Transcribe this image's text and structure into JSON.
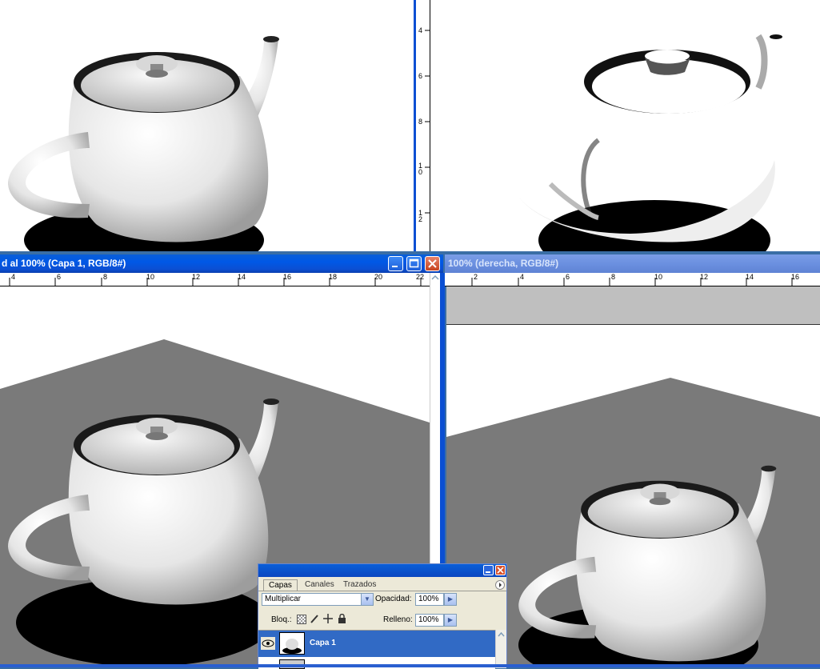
{
  "windows": {
    "bottom_left": {
      "title": "d al 100% (Capa 1, RGB/8#)",
      "ruler_top_labels": [
        "4",
        "6",
        "8",
        "10",
        "12",
        "14",
        "16",
        "18",
        "20",
        "22"
      ]
    },
    "bottom_right": {
      "title": "100% (derecha, RGB/8#)",
      "ruler_top_labels": [
        "2",
        "4",
        "6",
        "8",
        "10",
        "12",
        "14",
        "16"
      ]
    },
    "top_right": {
      "ruler_left_labels": [
        "4",
        "6",
        "8",
        "1 0",
        "1 2"
      ]
    }
  },
  "layers_panel": {
    "tabs": [
      "Capas",
      "Canales",
      "Trazados"
    ],
    "blend_mode": "Multiplicar",
    "opacity_label": "Opacidad:",
    "opacity_value": "100%",
    "lock_label": "Bloq.:",
    "fill_label": "Relleno:",
    "fill_value": "100%",
    "layers": [
      {
        "name": "Capa 1",
        "selected": true,
        "visible": true
      }
    ]
  },
  "icons": {
    "minimize": "minimize-icon",
    "maximize": "maximize-icon",
    "close": "close-icon",
    "eye": "eye-icon",
    "dropdown": "chevron-down-icon",
    "lock_transparency": "lock-transparency-icon",
    "lock_brush": "brush-icon",
    "lock_move": "move-icon",
    "lock_all": "padlock-icon",
    "panel_menu": "panel-menu-icon"
  },
  "colors": {
    "title_active": "#0058e6",
    "title_inactive": "#6b90e0",
    "selected_layer": "#316ac5",
    "plane_gray": "#7a7a7a"
  }
}
